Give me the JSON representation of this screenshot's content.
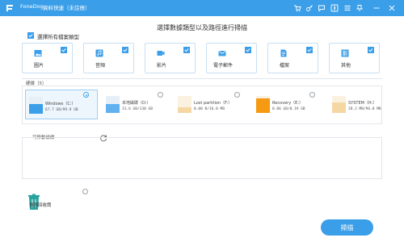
{
  "app": {
    "name": "FoneDog",
    "edition": "資料快速（未註冊）"
  },
  "heading": "選擇數據類型以及路徑進行掃描",
  "select_all": {
    "label": "選擇所有檔案類型",
    "checked": true
  },
  "file_types": [
    {
      "label": "圖片",
      "icon": "image-icon",
      "checked": true
    },
    {
      "label": "音頻",
      "icon": "music-icon",
      "checked": true
    },
    {
      "label": "影片",
      "icon": "video-icon",
      "checked": true
    },
    {
      "label": "電子郵件",
      "icon": "email-icon",
      "checked": true
    },
    {
      "label": "檔案",
      "icon": "document-icon",
      "checked": true
    },
    {
      "label": "其他",
      "icon": "other-icon",
      "checked": true
    }
  ],
  "hard_drives": {
    "label": "硬碟（5）",
    "drives": [
      {
        "name": "Windows（C:）",
        "size": "67.7 GB/99.9 GB",
        "selected": true,
        "bar_color": "#3a9ee8"
      },
      {
        "name": "本地磁碟（D:）",
        "size": "31.6 GB/130 GB",
        "selected": false,
        "bar_color": "#3a9ee8"
      },
      {
        "name": "Lost partition（F:）",
        "size": "0.00  B/16.0 MB",
        "selected": false,
        "bar_color": "#f5d7a4"
      },
      {
        "name": "Recovery（E:）",
        "size": "0.86 GB/0.19 GB",
        "selected": false,
        "bar_color": "#f59a12"
      },
      {
        "name": "SYSTEM（H:）",
        "size": "28.2 MB/96.0 MB",
        "selected": false,
        "bar_color": "#f5d7a4"
      }
    ]
  },
  "removable": {
    "label": "可移動磁碟"
  },
  "recycle_bin": {
    "label": "資源回收筒"
  },
  "scan_button": "掃描",
  "colors": {
    "accent": "#3a9ee8"
  }
}
